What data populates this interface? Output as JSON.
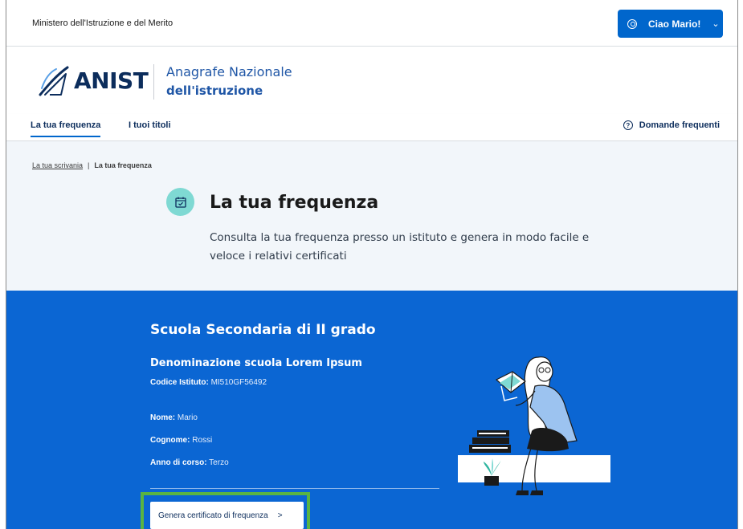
{
  "header": {
    "ministry": "Ministero dell'Istruzione e del Merito",
    "user_greeting": "Ciao Mario!",
    "user_icon": "user-circle-icon"
  },
  "brand": {
    "logo_text": "ANIST",
    "title_line1": "Anagrafe Nazionale",
    "title_line2": "dell'istruzione"
  },
  "nav": {
    "items": [
      {
        "label": "La tua frequenza",
        "active": true
      },
      {
        "label": "I tuoi titoli",
        "active": false
      }
    ],
    "faq_label": "Domande frequenti",
    "faq_icon": "help-circle-icon"
  },
  "breadcrumb": {
    "parent": "La tua scrivania",
    "separator": "|",
    "current": "La tua frequenza"
  },
  "hero": {
    "icon": "calendar-check-icon",
    "title": "La tua frequenza",
    "description": "Consulta la tua frequenza presso un istituto e genera in modo facile e veloce i relativi certificati"
  },
  "details": {
    "section_title": "Scuola Secondaria di II grado",
    "school_name": "Denominazione scuola Lorem Ipsum",
    "codice_label": "Codice Istituto:",
    "codice_value": "MI510GF56492",
    "nome_label": "Nome:",
    "nome_value": "Mario",
    "cognome_label": "Cognome:",
    "cognome_value": "Rossi",
    "anno_label": "Anno di corso:",
    "anno_value": "Terzo",
    "cta_label": "Genera certificato di frequenza",
    "cta_chevron": ">"
  },
  "colors": {
    "primary_blue": "#0066cc",
    "section_blue": "#0b66d3",
    "hero_bg": "#f2f6fa",
    "icon_teal": "#7fd9d3",
    "highlight_green": "#5ab443"
  }
}
